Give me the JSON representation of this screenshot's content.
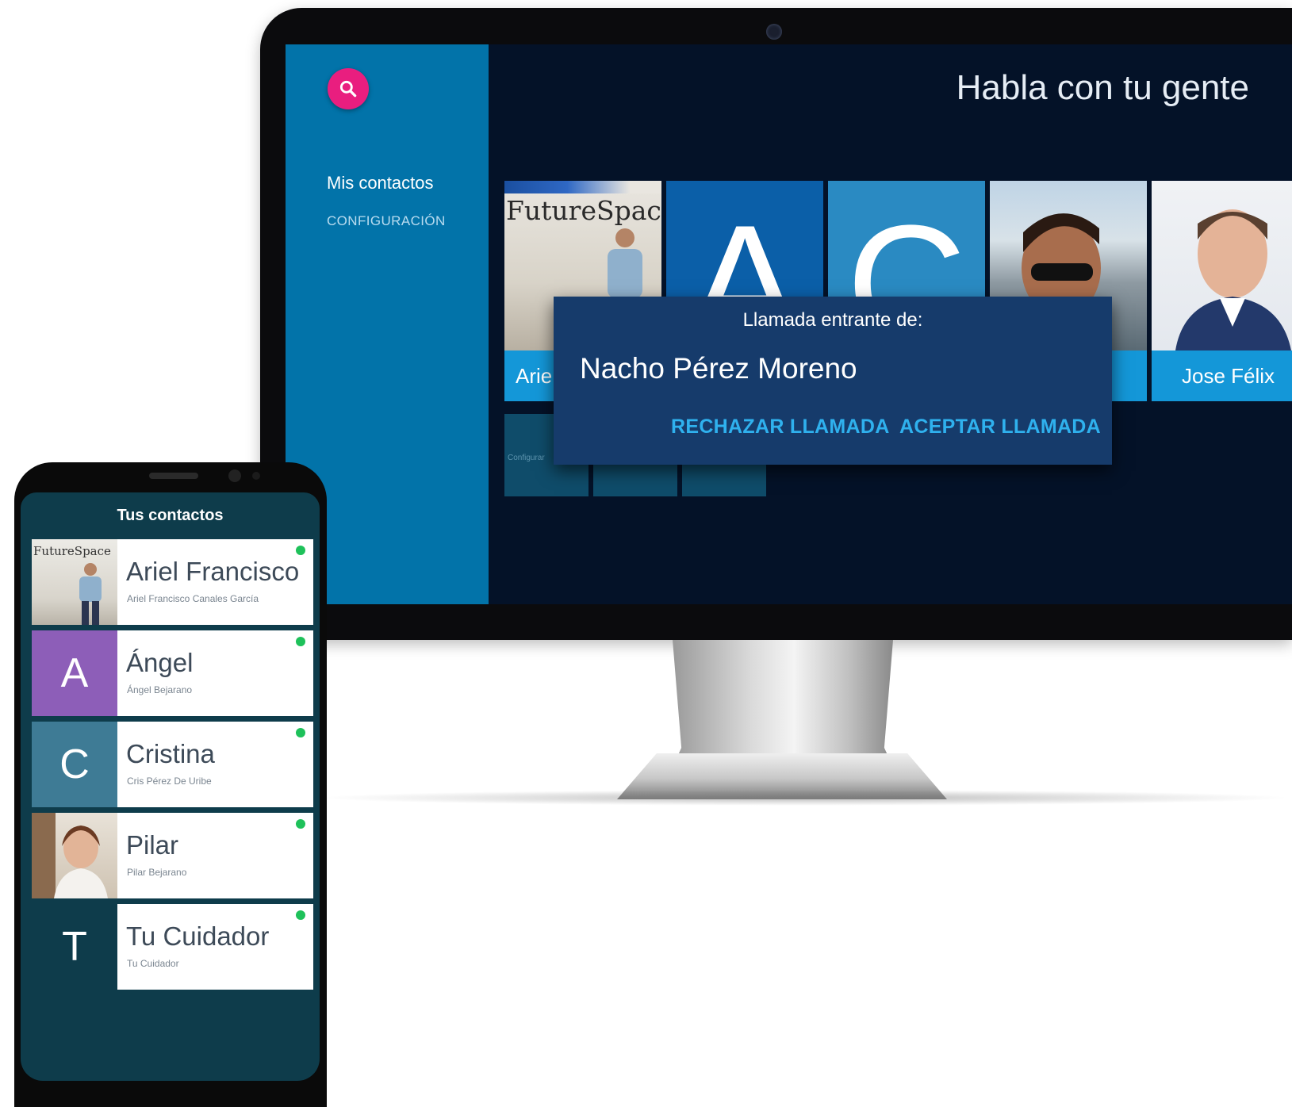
{
  "tv": {
    "search_icon": "search-icon",
    "nav": {
      "contacts": "Mis contactos",
      "settings": "CONFIGURACIÓN"
    },
    "title": "Habla con tu gente",
    "tiles": [
      {
        "label": "Ariel Francisco",
        "photo_text": "FutureSpace"
      },
      {
        "label": "",
        "letter": "A"
      },
      {
        "label": "",
        "letter": "C"
      },
      {
        "label": ""
      },
      {
        "label": "Jose Félix"
      }
    ],
    "small_tile_label": "Configurar",
    "call_dialog": {
      "header": "Llamada entrante de:",
      "caller": "Nacho Pérez Moreno",
      "reject": "RECHAZAR LLAMADA",
      "accept": "ACEPTAR LLAMADA"
    }
  },
  "phone": {
    "title": "Tus contactos",
    "contacts": [
      {
        "name": "Ariel Francisco",
        "full_name": "Ariel Francisco Canales García",
        "avatar": "photo",
        "photo_text": "FutureSpace",
        "online": true
      },
      {
        "name": "Ángel",
        "full_name": "Ángel Bejarano",
        "avatar_letter": "A",
        "avatar_color": "#8d5eb8",
        "online": true
      },
      {
        "name": "Cristina",
        "full_name": "Cris Pérez De Uribe",
        "avatar_letter": "C",
        "avatar_color": "#3e7b95",
        "online": true
      },
      {
        "name": "Pilar",
        "full_name": "Pilar Bejarano",
        "avatar": "photo",
        "online": true
      },
      {
        "name": "Tu Cuidador",
        "full_name": "Tu Cuidador",
        "avatar_letter": "T",
        "avatar_color": "#0e3c4b",
        "online": true
      }
    ]
  },
  "colors": {
    "sidebar": "#0273a9",
    "screen_bg": "#041228",
    "fab": "#e91e7f",
    "tile_label": "#1497d8",
    "dialog": "#163b6b",
    "dialog_button": "#2fb1ee",
    "phone_bg": "#0e3c4b",
    "online": "#1ec15a"
  }
}
